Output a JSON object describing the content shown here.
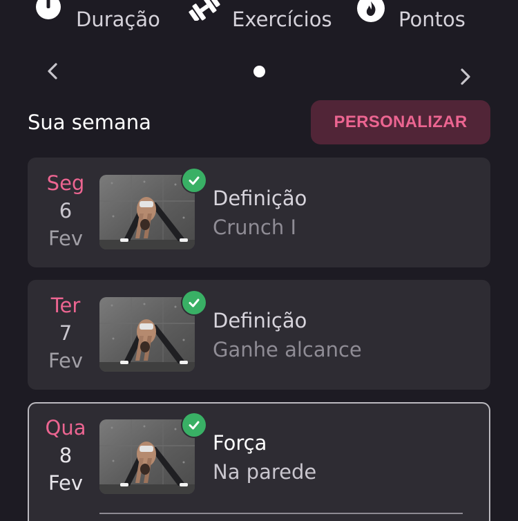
{
  "stats": [
    {
      "label": "Duração",
      "icon": "clock-icon"
    },
    {
      "label": "Exercícios",
      "icon": "dumbbell-icon"
    },
    {
      "label": "Pontos",
      "icon": "flame-icon"
    }
  ],
  "pager": {
    "prev_icon": "chevron-left-icon",
    "next_icon": "chevron-right-icon"
  },
  "week": {
    "title": "Sua semana",
    "customize_label": "PERSONALIZAR",
    "days": [
      {
        "weekday": "Seg",
        "day": "6",
        "month": "Fev",
        "title": "Definição",
        "subtitle": "Crunch I",
        "completed": true,
        "selected": false
      },
      {
        "weekday": "Ter",
        "day": "7",
        "month": "Fev",
        "title": "Definição",
        "subtitle": "Ganhe alcance",
        "completed": true,
        "selected": false
      },
      {
        "weekday": "Qua",
        "day": "8",
        "month": "Fev",
        "title": "Força",
        "subtitle": "Na parede",
        "completed": true,
        "selected": true
      }
    ]
  },
  "colors": {
    "background": "#1d1b23",
    "card": "#2e2c33",
    "accent": "#ec6591",
    "button_bg": "#512537",
    "check": "#39b065"
  }
}
